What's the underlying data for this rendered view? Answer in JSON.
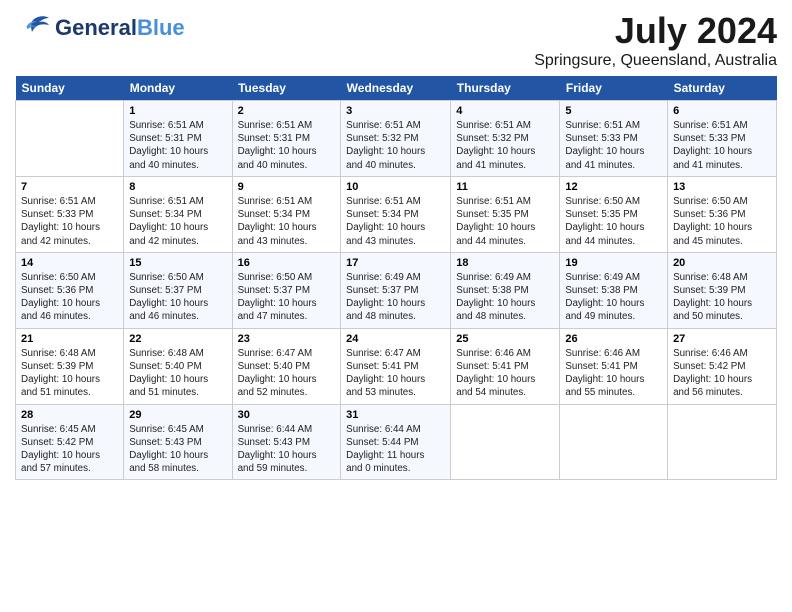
{
  "header": {
    "logo_general": "General",
    "logo_blue": "Blue",
    "title": "July 2024",
    "subtitle": "Springsure, Queensland, Australia"
  },
  "days_of_week": [
    "Sunday",
    "Monday",
    "Tuesday",
    "Wednesday",
    "Thursday",
    "Friday",
    "Saturday"
  ],
  "weeks": [
    [
      {
        "num": "",
        "info": ""
      },
      {
        "num": "1",
        "info": "Sunrise: 6:51 AM\nSunset: 5:31 PM\nDaylight: 10 hours\nand 40 minutes."
      },
      {
        "num": "2",
        "info": "Sunrise: 6:51 AM\nSunset: 5:31 PM\nDaylight: 10 hours\nand 40 minutes."
      },
      {
        "num": "3",
        "info": "Sunrise: 6:51 AM\nSunset: 5:32 PM\nDaylight: 10 hours\nand 40 minutes."
      },
      {
        "num": "4",
        "info": "Sunrise: 6:51 AM\nSunset: 5:32 PM\nDaylight: 10 hours\nand 41 minutes."
      },
      {
        "num": "5",
        "info": "Sunrise: 6:51 AM\nSunset: 5:33 PM\nDaylight: 10 hours\nand 41 minutes."
      },
      {
        "num": "6",
        "info": "Sunrise: 6:51 AM\nSunset: 5:33 PM\nDaylight: 10 hours\nand 41 minutes."
      }
    ],
    [
      {
        "num": "7",
        "info": "Sunrise: 6:51 AM\nSunset: 5:33 PM\nDaylight: 10 hours\nand 42 minutes."
      },
      {
        "num": "8",
        "info": "Sunrise: 6:51 AM\nSunset: 5:34 PM\nDaylight: 10 hours\nand 42 minutes."
      },
      {
        "num": "9",
        "info": "Sunrise: 6:51 AM\nSunset: 5:34 PM\nDaylight: 10 hours\nand 43 minutes."
      },
      {
        "num": "10",
        "info": "Sunrise: 6:51 AM\nSunset: 5:34 PM\nDaylight: 10 hours\nand 43 minutes."
      },
      {
        "num": "11",
        "info": "Sunrise: 6:51 AM\nSunset: 5:35 PM\nDaylight: 10 hours\nand 44 minutes."
      },
      {
        "num": "12",
        "info": "Sunrise: 6:50 AM\nSunset: 5:35 PM\nDaylight: 10 hours\nand 44 minutes."
      },
      {
        "num": "13",
        "info": "Sunrise: 6:50 AM\nSunset: 5:36 PM\nDaylight: 10 hours\nand 45 minutes."
      }
    ],
    [
      {
        "num": "14",
        "info": "Sunrise: 6:50 AM\nSunset: 5:36 PM\nDaylight: 10 hours\nand 46 minutes."
      },
      {
        "num": "15",
        "info": "Sunrise: 6:50 AM\nSunset: 5:37 PM\nDaylight: 10 hours\nand 46 minutes."
      },
      {
        "num": "16",
        "info": "Sunrise: 6:50 AM\nSunset: 5:37 PM\nDaylight: 10 hours\nand 47 minutes."
      },
      {
        "num": "17",
        "info": "Sunrise: 6:49 AM\nSunset: 5:37 PM\nDaylight: 10 hours\nand 48 minutes."
      },
      {
        "num": "18",
        "info": "Sunrise: 6:49 AM\nSunset: 5:38 PM\nDaylight: 10 hours\nand 48 minutes."
      },
      {
        "num": "19",
        "info": "Sunrise: 6:49 AM\nSunset: 5:38 PM\nDaylight: 10 hours\nand 49 minutes."
      },
      {
        "num": "20",
        "info": "Sunrise: 6:48 AM\nSunset: 5:39 PM\nDaylight: 10 hours\nand 50 minutes."
      }
    ],
    [
      {
        "num": "21",
        "info": "Sunrise: 6:48 AM\nSunset: 5:39 PM\nDaylight: 10 hours\nand 51 minutes."
      },
      {
        "num": "22",
        "info": "Sunrise: 6:48 AM\nSunset: 5:40 PM\nDaylight: 10 hours\nand 51 minutes."
      },
      {
        "num": "23",
        "info": "Sunrise: 6:47 AM\nSunset: 5:40 PM\nDaylight: 10 hours\nand 52 minutes."
      },
      {
        "num": "24",
        "info": "Sunrise: 6:47 AM\nSunset: 5:41 PM\nDaylight: 10 hours\nand 53 minutes."
      },
      {
        "num": "25",
        "info": "Sunrise: 6:46 AM\nSunset: 5:41 PM\nDaylight: 10 hours\nand 54 minutes."
      },
      {
        "num": "26",
        "info": "Sunrise: 6:46 AM\nSunset: 5:41 PM\nDaylight: 10 hours\nand 55 minutes."
      },
      {
        "num": "27",
        "info": "Sunrise: 6:46 AM\nSunset: 5:42 PM\nDaylight: 10 hours\nand 56 minutes."
      }
    ],
    [
      {
        "num": "28",
        "info": "Sunrise: 6:45 AM\nSunset: 5:42 PM\nDaylight: 10 hours\nand 57 minutes."
      },
      {
        "num": "29",
        "info": "Sunrise: 6:45 AM\nSunset: 5:43 PM\nDaylight: 10 hours\nand 58 minutes."
      },
      {
        "num": "30",
        "info": "Sunrise: 6:44 AM\nSunset: 5:43 PM\nDaylight: 10 hours\nand 59 minutes."
      },
      {
        "num": "31",
        "info": "Sunrise: 6:44 AM\nSunset: 5:44 PM\nDaylight: 11 hours\nand 0 minutes."
      },
      {
        "num": "",
        "info": ""
      },
      {
        "num": "",
        "info": ""
      },
      {
        "num": "",
        "info": ""
      }
    ]
  ]
}
